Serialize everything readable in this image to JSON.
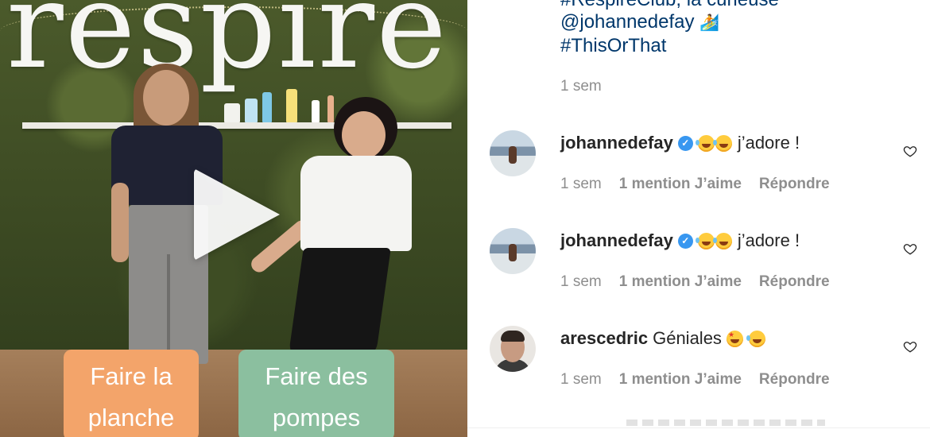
{
  "video": {
    "logo_text": "respire",
    "label_left": "Faire la planche",
    "label_right": "Faire des pompes"
  },
  "caption": {
    "line_partial": "#RespireClub, la curieuse",
    "mention": "@johannedefay",
    "hashtag": "#ThisOrThat",
    "time": "1 sem"
  },
  "comments": [
    {
      "user": "johannedefay",
      "verified": true,
      "text": "j’adore !",
      "time": "1 sem",
      "likes": "1 mention J’aime",
      "reply": "Répondre"
    },
    {
      "user": "johannedefay",
      "verified": true,
      "text": "j’adore !",
      "time": "1 sem",
      "likes": "1 mention J’aime",
      "reply": "Répondre"
    },
    {
      "user": "arescedric",
      "verified": false,
      "text": "Géniales",
      "time": "1 sem",
      "likes": "1 mention J’aime",
      "reply": "Répondre"
    }
  ],
  "icons": {
    "play": "play-icon",
    "heart": "heart-outline-icon",
    "verified": "verified-badge-icon",
    "emoji_laugh": "face-with-tears-of-joy-icon",
    "emoji_star": "star-struck-icon",
    "surfer": "surfer-icon"
  },
  "colors": {
    "link": "#00376b",
    "meta": "#8e8e8e",
    "verified": "#3897f0",
    "label_orange": "#f3a46a",
    "label_green": "#8bbf9f"
  }
}
